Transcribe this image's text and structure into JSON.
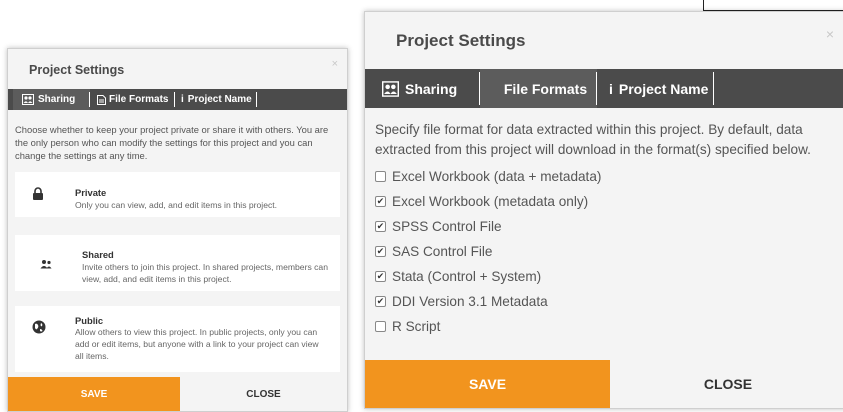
{
  "left_dialog": {
    "title": "Project Settings",
    "close_x": "×",
    "tabs": [
      {
        "label": "Sharing",
        "icon": "people-icon",
        "active": true
      },
      {
        "label": "File Formats",
        "icon": "file-icon",
        "active": false
      },
      {
        "label": "Project Name",
        "icon": "info-icon",
        "active": false
      }
    ],
    "intro": "Choose whether to keep your project private or share it with others. You are the only person who can modify the settings for this project and you can change the settings at any time.",
    "options": [
      {
        "name": "Private",
        "icon": "lock-icon",
        "description": "Only you can view, add, and edit items in this project."
      },
      {
        "name": "Shared",
        "icon": "users-icon",
        "description": "Invite others to join this project. In shared projects, members can view, add, and edit items in this project."
      },
      {
        "name": "Public",
        "icon": "globe-icon",
        "description": "Allow others to view this project. In public projects, only you can add or edit items, but anyone with a link to your project can view all items."
      }
    ],
    "save_label": "SAVE",
    "close_label": "CLOSE"
  },
  "right_dialog": {
    "title": "Project Settings",
    "close_x": "×",
    "tabs": [
      {
        "label": "Sharing",
        "icon": "people-icon",
        "active": false
      },
      {
        "label": "File Formats",
        "icon": "",
        "active": true
      },
      {
        "label": "Project Name",
        "icon": "info-icon",
        "active": false
      }
    ],
    "intro": "Specify file format for data extracted within this project. By default, data extracted from this project will download in the format(s) specified below.",
    "formats": [
      {
        "label": "Excel Workbook (data + metadata)",
        "checked": false
      },
      {
        "label": "Excel Workbook (metadata only)",
        "checked": true
      },
      {
        "label": "SPSS Control File",
        "checked": true
      },
      {
        "label": "SAS Control File",
        "checked": true
      },
      {
        "label": "Stata (Control + System)",
        "checked": true
      },
      {
        "label": "DDI Version 3.1 Metadata",
        "checked": true
      },
      {
        "label": "R Script",
        "checked": false
      }
    ],
    "save_label": "SAVE",
    "close_label": "CLOSE"
  },
  "colors": {
    "accent": "#f2941e",
    "tabbar": "#4b4b4b",
    "dialog_bg": "#f4f4f4"
  }
}
